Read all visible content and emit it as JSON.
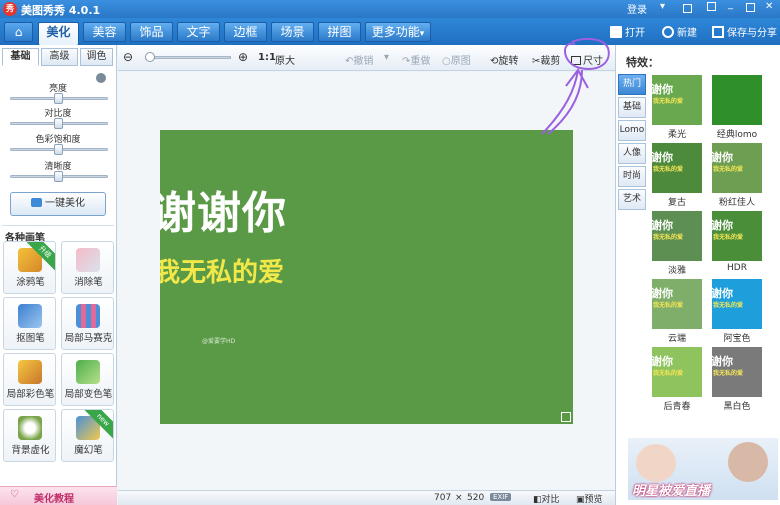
{
  "titlebar": {
    "logo": "秀",
    "title": "美图秀秀 4.0.1",
    "login": "登录"
  },
  "menu": {
    "tabs": [
      "美化",
      "美容",
      "饰品",
      "文字",
      "边框",
      "场景",
      "拼图",
      "更多功能"
    ],
    "more_arrow": "▾",
    "actions": {
      "open": "打开",
      "new": "新建",
      "save_share": "保存与分享"
    }
  },
  "left_panel": {
    "tabs": [
      "基础",
      "高级",
      "调色"
    ],
    "sliders": [
      {
        "label": "亮度",
        "value": 0.5
      },
      {
        "label": "对比度",
        "value": 0.5
      },
      {
        "label": "色彩饱和度",
        "value": 0.5
      },
      {
        "label": "清晰度",
        "value": 0.5
      }
    ],
    "one_key_button": "一键美化",
    "brushes_title": "各种画笔",
    "brushes": [
      {
        "label": "涂鸦笔",
        "badge": "升级"
      },
      {
        "label": "消除笔",
        "badge": ""
      },
      {
        "label": "抠图笔",
        "badge": ""
      },
      {
        "label": "局部马赛克",
        "badge": ""
      },
      {
        "label": "局部彩色笔",
        "badge": ""
      },
      {
        "label": "局部变色笔",
        "badge": ""
      },
      {
        "label": "背景虚化",
        "badge": ""
      },
      {
        "label": "魔幻笔",
        "badge": "new"
      }
    ],
    "tutorial": "美化教程"
  },
  "toolbar": {
    "ratio": "1:1",
    "original_size": "原大",
    "undo": "撤销",
    "redo": "重做",
    "original_image": "原图",
    "rotate": "旋转",
    "crop": "裁剪",
    "resize": "尺寸"
  },
  "photo": {
    "line1": "谢谢你",
    "line2": "我无私的爱",
    "watermark": "@爱要学HD"
  },
  "status": {
    "width": "707",
    "times": "×",
    "height": "520",
    "exif": "EXIF",
    "compare": "对比",
    "preview": "预览"
  },
  "right_panel": {
    "title": "特效：",
    "categories": [
      "热门",
      "基础",
      "Lomo",
      "人像",
      "时尚",
      "艺术"
    ],
    "effects": [
      {
        "label": "柔光",
        "tile": {
          "t1": "谢你",
          "t2": "我无私的爱"
        },
        "color": "#6aa84f"
      },
      {
        "label": "经典lomo",
        "tile": {
          "t1": "",
          "t2": ""
        },
        "color": "#2f8f2a"
      },
      {
        "label": "复古",
        "tile": {
          "t1": "谢你",
          "t2": "我无私的爱"
        },
        "color": "#4e8a3c"
      },
      {
        "label": "粉红佳人",
        "tile": {
          "t1": "谢你",
          "t2": "我无私的爱"
        },
        "color": "#6e9e52"
      },
      {
        "label": "淡雅",
        "tile": {
          "t1": "谢你",
          "t2": "我无私的爱"
        },
        "color": "#5e8f52"
      },
      {
        "label": "HDR",
        "tile": {
          "t1": "谢你",
          "t2": "我无私的爱"
        },
        "color": "#4a8e3a"
      },
      {
        "label": "云端",
        "tile": {
          "t1": "谢你",
          "t2": "我无私的爱"
        },
        "color": "#7fae6a"
      },
      {
        "label": "阿宝色",
        "tile": {
          "t1": "谢你",
          "t2": "我无私的爱"
        },
        "color": "#1e9fdc"
      },
      {
        "label": "后青春",
        "tile": {
          "t1": "谢你",
          "t2": "我无私的爱"
        },
        "color": "#8fc35e"
      },
      {
        "label": "黑白色",
        "tile": {
          "t1": "谢你",
          "t2": "我无私的爱"
        },
        "color": "#7a7a7a"
      }
    ],
    "ad": {
      "text": "明星被爱直播"
    }
  }
}
